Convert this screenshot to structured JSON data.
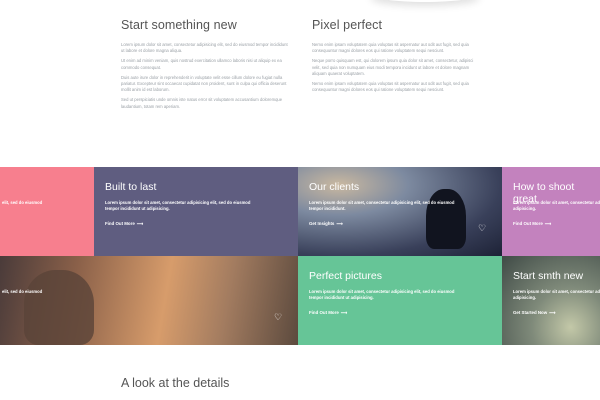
{
  "intro": {
    "left": {
      "title": "Start something new",
      "paragraphs": [
        "Lorem ipsum dolor sit amet, consectetur adipisicing elit, sed do eiusmod tempor incididunt ut labore et dolore magna aliqua.",
        "Ut enim ad minim veniam, quis nostrud exercitation ullamco laboris nisi ut aliquip ex ea commodo consequat.",
        "Duis aute irure dolor in reprehenderit in voluptate velit esse cillum dolore eu fugiat nulla pariatur. Excepteur sint occaecat cupidatat non proident, sunt in culpa qui officia deserunt mollit anim id est laborum.",
        "Sed ut perspiciatis unde omnis iste natus error sit voluptatem accusantium doloremque laudantium, totam rem aperiam."
      ]
    },
    "right": {
      "title": "Pixel perfect",
      "paragraphs": [
        "Nemo enim ipsam voluptatem quia voluptas sit aspernatur aut odit aut fugit, sed quia consequuntur magni dolores eos qui ratione voluptatem sequi nesciunt.",
        "Neque porro quisquam est, qui dolorem ipsum quia dolor sit amet, consectetur, adipisci velit, sed quia non numquam eius modi tempora incidunt ut labore et dolore magnam aliquam quaerat voluptatem.",
        "Nemo enim ipsam voluptatem quia voluptas sit aspernatur aut odit aut fugit, sed quia consequuntur magni dolores eos qui ratione voluptatem sequi nesciunt."
      ]
    }
  },
  "tiles": {
    "t1": {
      "desc": "elit, sed do eiusmod"
    },
    "t2": {
      "title": "Built to last",
      "desc": "Lorem ipsum dolor sit amet, consectetur adipisicing elit, sed do eiusmod tempor incididunt ut adipisicing.",
      "cta": "Find Out More",
      "color": "#5f5d80"
    },
    "t3": {
      "title": "Our clients",
      "desc": "Lorem ipsum dolor sit amet, consectetur adipisicing elit, sed do eiusmod tempor incididunt.",
      "cta": "Get Insights"
    },
    "t4": {
      "title": "How to shoot great",
      "desc": "Lorem ipsum dolor sit amet, consectetur adipisicing tempor incididunt ut adipisicing.",
      "cta": "Find Out More",
      "color": "#c382be"
    },
    "t5": {
      "desc": "elit, sed do eiusmod"
    },
    "t6": {
      "title": "Perfect pictures",
      "desc": "Lorem ipsum dolor sit amet, consectetur adipisicing elit, sed do eiusmod tempor incididunt ut adipisicing.",
      "cta": "Find Out More",
      "color": "#66c597"
    },
    "t7": {
      "title": "Start smth new",
      "desc": "Lorem ipsum dolor sit amet, consectetur adipisicing tempor incididunt ut adipisicing.",
      "cta": "Get Started Now"
    }
  },
  "details": {
    "title": "A look at the details"
  },
  "colors": {
    "pink": "#f77f8e",
    "slate": "#5f5d80",
    "purple": "#c382be",
    "green": "#66c597"
  },
  "icons": {
    "heart": "heart-icon",
    "arrow": "arrow-right-icon"
  }
}
